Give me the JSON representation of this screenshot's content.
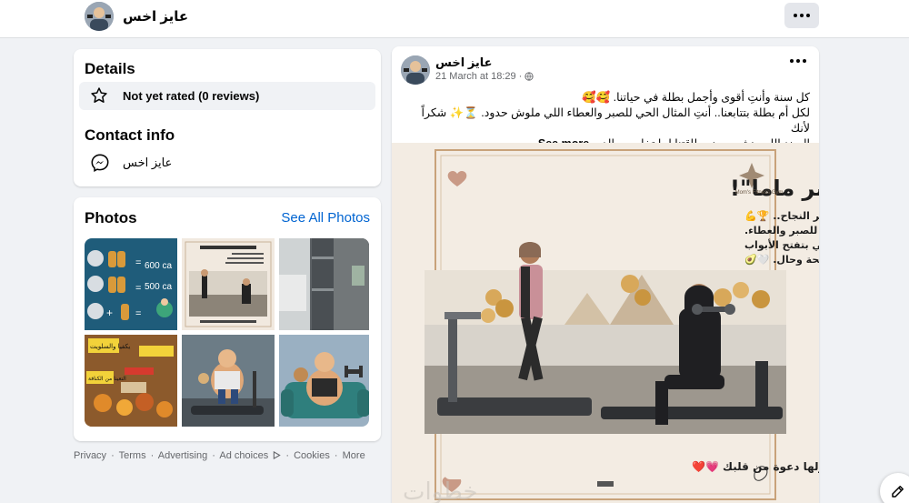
{
  "header": {
    "profile_name": "عايز اخس",
    "more_icon": "more-horizontal-icon"
  },
  "details": {
    "title": "Details",
    "rating_text": "Not yet rated (0 reviews)",
    "rating_icon": "star-outline-icon"
  },
  "contact": {
    "title": "Contact info",
    "messenger_name": "عايز اخس",
    "messenger_icon": "messenger-icon"
  },
  "photos": {
    "title": "Photos",
    "see_all": "See All Photos",
    "tiles": [
      {
        "name": "photo-math-puzzle",
        "labels": [
          "600 ca",
          "500 ca"
        ]
      },
      {
        "name": "photo-mothers-day-gym"
      },
      {
        "name": "photo-fridge"
      },
      {
        "name": "photo-junk-food",
        "labels": [
          "يكفيا والسلويت",
          "التعينا من الكنافة"
        ]
      },
      {
        "name": "photo-treadmill-cartoon"
      },
      {
        "name": "photo-couch-cartoon"
      }
    ]
  },
  "footer": {
    "links": [
      "Privacy",
      "Terms",
      "Advertising",
      "Ad choices",
      "Cookies",
      "More"
    ],
    "separator": "·"
  },
  "post": {
    "author": "عايز اخس",
    "date": "21 March at 18:29",
    "privacy_icon": "globe-icon",
    "text_line1": "كل سنة وأنتِ أقوى وأجمل بطلة في حياتنا. 🥰🥰",
    "text_line2": "لكل أم بطلة بتتابعنا.. أنتِ المثال الحي للصبر والعطاء اللي ملوش حدود. ⏳✨ شكراً لأنك",
    "text_line3": "السند اللي بنشحن منه طاقتنا لما تخلص، والد...",
    "see_more": "See more",
    "image": {
      "headline": "عيد أم سعيد لكل \"سوبر ماما\"!",
      "line1": "الاستمرارية هي سر النجاح.. 🏆💪",
      "line2": "أنتِ يا أمي أعظم مثال للصبر والعطاء.",
      "line3": "شكراً لأنكِ السند والدعوة الحلوة اللي بتفتح الأبواب",
      "line4": "كل سنة وأنتِ بألف صحة وحال. 🤍🥑",
      "footer_text": "منشن لست الحبايب وقولها دعوة من قلبك 💗❤️",
      "badge": "Mom's Fitness Gym",
      "watermark": "خطوات",
      "accent": "#c8a27a"
    }
  },
  "fab_icon": "edit-compose-icon"
}
